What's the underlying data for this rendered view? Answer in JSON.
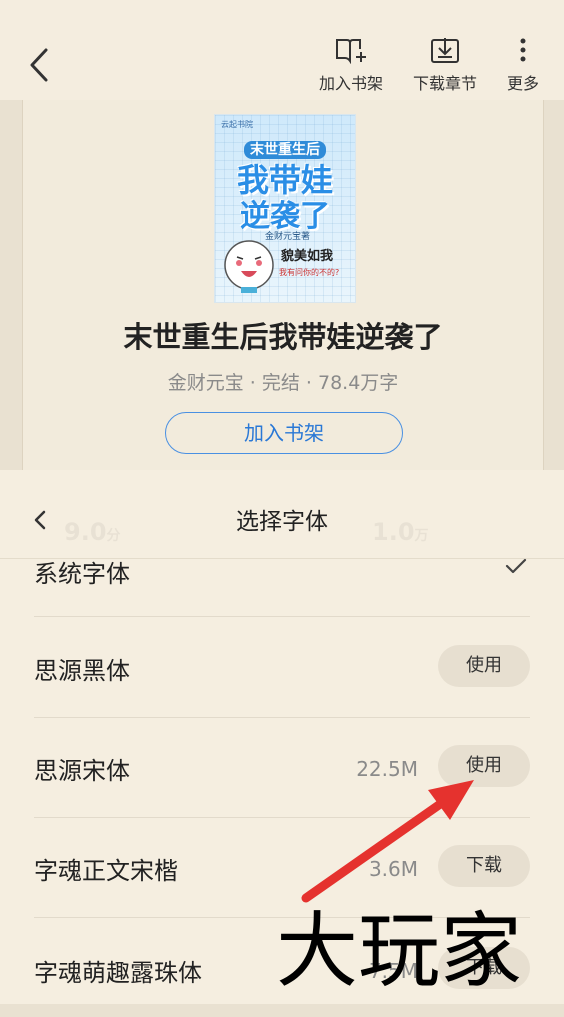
{
  "top_actions": {
    "add_shelf": "加入书架",
    "download": "下载章节",
    "more": "更多"
  },
  "book": {
    "cover": {
      "logo": "云起书院",
      "line1": "末世重生后",
      "line2": "我带娃",
      "line3": "逆袭了",
      "author_tag": "金财元宝",
      "author_suffix": "著",
      "slogan1": "貌美如我",
      "slogan2": "我有问你的不的?"
    },
    "title": "末世重生后我带娃逆袭了",
    "author": "金财元宝",
    "status": "完结",
    "words": "78.4万字",
    "meta_sep": " · ",
    "add_shelf_btn": "加入书架"
  },
  "background": {
    "rating": "9.0",
    "rating_unit": "分",
    "count": "1.0",
    "count_unit": "万"
  },
  "font_sheet": {
    "title": "选择字体",
    "fonts": [
      {
        "name": "系统字体",
        "size": "",
        "action": "",
        "selected": true
      },
      {
        "name": "思源黑体",
        "size": "",
        "action": "使用",
        "selected": false
      },
      {
        "name": "思源宋体",
        "size": "22.5M",
        "action": "使用",
        "selected": false
      },
      {
        "name": "字魂正文宋楷",
        "size": "3.6M",
        "action": "下载",
        "selected": false
      },
      {
        "name": "字魂萌趣露珠体",
        "size": "7.5M",
        "action": "下载",
        "selected": false
      }
    ]
  },
  "watermark": "大玩家",
  "colors": {
    "sheet_bg": "#f5eee0",
    "accent": "#2a78d6",
    "arrow": "#e5322e"
  },
  "icons": {
    "back": "back-chevron-icon",
    "add_shelf": "book-plus-icon",
    "download": "download-box-icon",
    "more": "more-vertical-icon",
    "selected": "check-icon"
  }
}
